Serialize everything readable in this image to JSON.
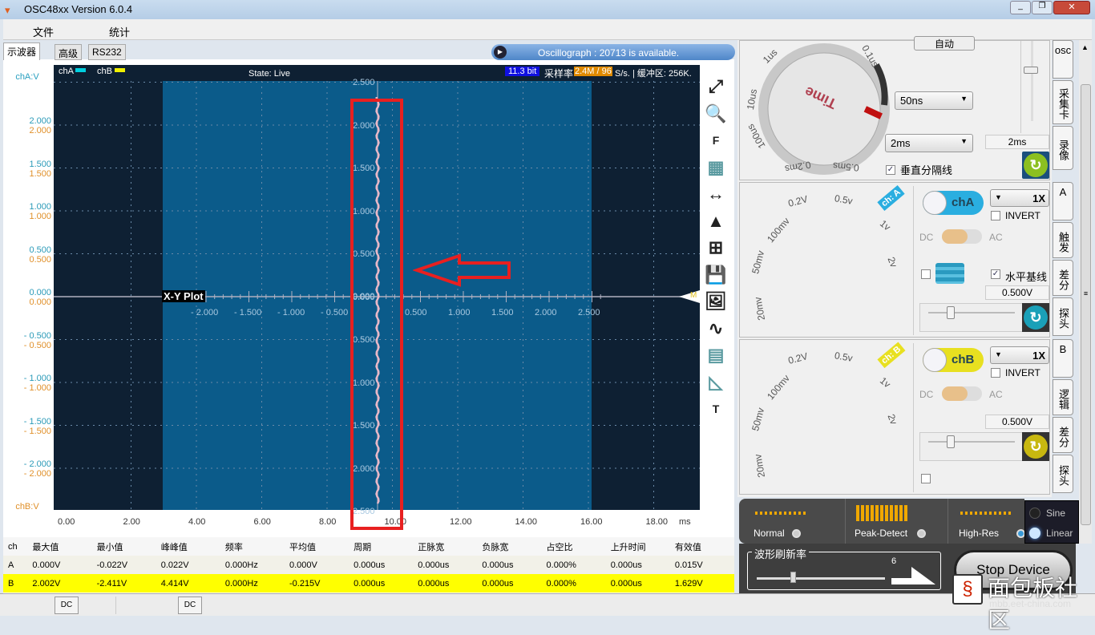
{
  "window": {
    "title": "OSC48xx  Version 6.0.4"
  },
  "menu": [
    "文件",
    "统计"
  ],
  "tabs": [
    "示波器",
    "高级",
    "RS232"
  ],
  "banner": "Oscillograph : 20713 is available.",
  "plot": {
    "legend": {
      "cha": "chA",
      "chb": "chB",
      "cha_color": "#00d0e0",
      "chb_color": "#f0f000"
    },
    "state": "State: Live",
    "bits": "11.3 bit",
    "rate_label": "采样率",
    "rate_value": "2.4M / 96",
    "rate_unit": "S/s. | 缓冲区: 256K.",
    "mode_label": "X-Y Plot",
    "cha_axis_label": "chA:V",
    "chb_axis_label": "chB:V",
    "y_ticks": [
      "2.000",
      "1.500",
      "1.000",
      "0.500",
      "0.000",
      "- 0.500",
      "- 1.000",
      "- 1.500",
      "- 2.000"
    ],
    "x_ticks": [
      "0.00",
      "2.00",
      "4.00",
      "6.00",
      "8.00",
      "10.00",
      "12.00",
      "14.00",
      "16.00",
      "18.00"
    ],
    "x_unit": "ms",
    "center_x_ticks": [
      "- 2.000",
      "- 1.500",
      "- 1.000",
      "- 0.500",
      "0.000",
      "0.500",
      "1.000",
      "1.500",
      "2.000",
      "2.500"
    ],
    "center_y_ticks": [
      "2.500",
      "2.000",
      "1.500",
      "1.000",
      "0.500",
      "0.000",
      "0.500",
      "1.000",
      "1.500",
      "2.000",
      "2.500"
    ],
    "marker": "M",
    "annotation_color": "#e82020"
  },
  "tools": [
    "fit-icon",
    "zoom-in-icon",
    "F",
    "grid-icon",
    "measure-width-icon",
    "spectrum-icon",
    "calculator-icon",
    "save-icon",
    "image-icon",
    "waveform-icon",
    "table-icon",
    "ruler-icon",
    "T"
  ],
  "measurements": {
    "headers": [
      "ch",
      "最大值",
      "最小值",
      "峰峰值",
      "频率",
      "平均值",
      "周期",
      "正脉宽",
      "负脉宽",
      "占空比",
      "上升时间",
      "有效值"
    ],
    "rows": [
      [
        "A",
        "0.000V",
        "-0.022V",
        "0.022V",
        "0.000Hz",
        "0.000V",
        "0.000us",
        "0.000us",
        "0.000us",
        "0.000%",
        "0.000us",
        "0.015V"
      ],
      [
        "B",
        "2.002V",
        "-2.411V",
        "4.414V",
        "0.000Hz",
        "-0.215V",
        "0.000us",
        "0.000us",
        "0.000us",
        "0.000%",
        "0.000us",
        "1.629V"
      ]
    ]
  },
  "status": {
    "dc1": "DC",
    "dc2": "DC"
  },
  "timebase": {
    "auto_button": "自动",
    "dial_label": "Time",
    "dial_ticks": [
      "1us",
      "0.1us",
      "10us",
      "100us",
      "0.2ms",
      "0.5ms"
    ],
    "select1": "50ns",
    "select2": "2ms",
    "value": "2ms",
    "vertical_grid_label": "垂直分隔线",
    "vertical_grid_checked": true
  },
  "channel_a": {
    "dial_ticks": [
      "20mv",
      "50mv",
      "100mv",
      "0.2V",
      "0.5v",
      "1v",
      "2v"
    ],
    "tag": "ch: A",
    "toggle": "chA",
    "probe": "1X",
    "invert": "INVERT",
    "dc": "DC",
    "ac": "AC",
    "baseline_label": "水平基线",
    "baseline_checked": true,
    "offset": "0.500V",
    "color": "#2aaee0"
  },
  "channel_b": {
    "dial_ticks": [
      "20mv",
      "50mv",
      "100mv",
      "0.2V",
      "0.5v",
      "1v",
      "2v"
    ],
    "tag": "ch: B",
    "toggle": "chB",
    "probe": "1X",
    "invert": "INVERT",
    "dc": "DC",
    "ac": "AC",
    "offset": "0.500V",
    "color": "#e8e020"
  },
  "side_tabs": [
    "osc",
    "采集卡",
    "录像",
    "A",
    "触发",
    "差分",
    "探头",
    "B",
    "逻辑",
    "差分",
    "探头"
  ],
  "acq_modes": {
    "items": [
      "Normal",
      "Peak-Detect",
      "High-Res"
    ],
    "selected": "High-Res"
  },
  "interp": {
    "items": [
      "Sine",
      "Linear"
    ],
    "selected": "Linear"
  },
  "refresh": {
    "label": "波形刷新率",
    "value": "6"
  },
  "stop_button": "Stop Device",
  "watermark": {
    "text": "面包板社区",
    "url": "mbb.eet-china.com"
  }
}
